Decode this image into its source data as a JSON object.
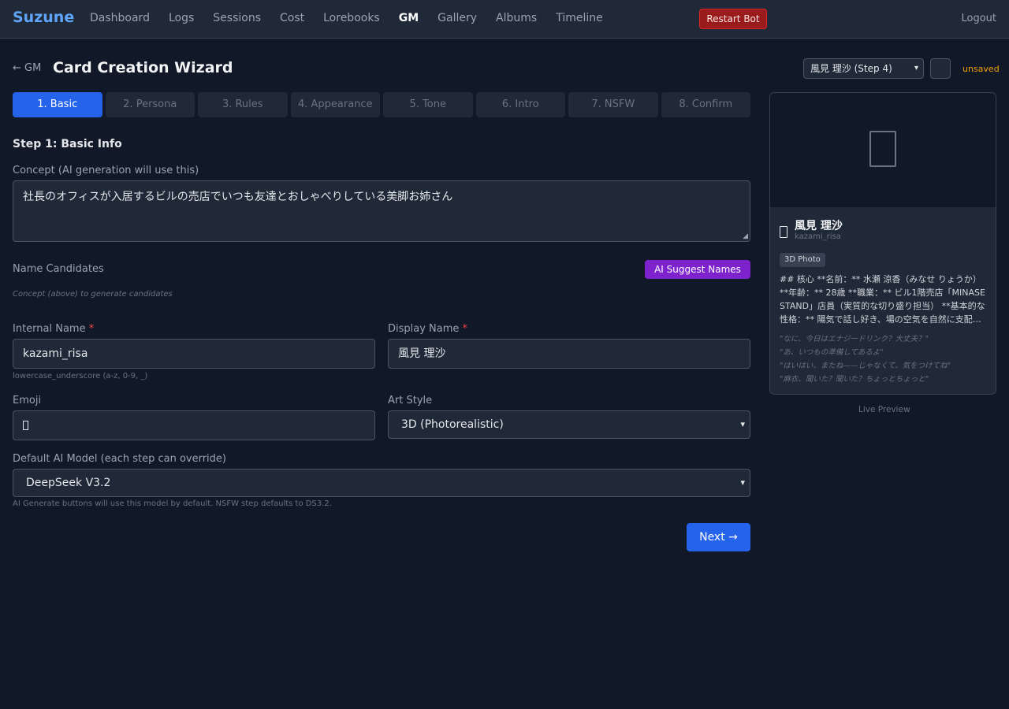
{
  "nav": {
    "brand": "Suzune",
    "links": [
      "Dashboard",
      "Logs",
      "Sessions",
      "Cost",
      "Lorebooks",
      "GM",
      "Gallery",
      "Albums",
      "Timeline"
    ],
    "active": "GM",
    "restart_label": "Restart Bot",
    "logout_label": "Logout"
  },
  "header": {
    "back_label": "← GM",
    "title": "Card Creation Wizard",
    "character_select": "風見 理沙 (Step 4)",
    "small_button": "",
    "status": "unsaved"
  },
  "steps": [
    "1. Basic",
    "2. Persona",
    "3. Rules",
    "4. Appearance",
    "5. Tone",
    "6. Intro",
    "7. NSFW",
    "8. Confirm"
  ],
  "active_step": 0,
  "form": {
    "section_title": "Step 1: Basic Info",
    "concept_label": "Concept (AI generation will use this)",
    "concept_value": "社長のオフィスが入居するビルの売店でいつも友達とおしゃべりしている美脚お姉さん",
    "name_candidates_label": "Name Candidates",
    "suggest_button": "AI Suggest Names",
    "candidates_hint": "Concept (above) to generate candidates",
    "internal_name_label": "Internal Name",
    "internal_name_value": "kazami_risa",
    "internal_name_hint": "lowercase_underscore (a-z, 0-9, _)",
    "display_name_label": "Display Name",
    "display_name_value": "風見 理沙",
    "required_mark": "*",
    "emoji_label": "Emoji",
    "art_style_label": "Art Style",
    "art_style_value": "3D (Photorealistic)",
    "model_label": "Default AI Model (each step can override)",
    "model_value": "DeepSeek V3.2",
    "model_hint": "AI Generate buttons will use this model by default. NSFW step defaults to DS3.2.",
    "next_button": "Next →"
  },
  "preview": {
    "name": "風見 理沙",
    "id": "kazami_risa",
    "badge": "3D Photo",
    "description": "## 核心 **名前：** 水瀬 涼香（みなせ りょうか） **年齢：** 28歳 **職業：** ビル1階売店「MINASE STAND」店員（実質的な切り盛り担当） **基本的な性格：** 陽気で話し好き、場の空気を自然に支配…",
    "quotes": [
      "\"なに、今日はエナジードリンク？大丈夫？\"",
      "\"あ、いつもの準備してあるよ\"",
      "\"はいはい、またね——じゃなくて、気をつけてね\"",
      "\"麻衣、聞いた？聞いた？ちょっとちょっと\""
    ],
    "caption": "Live Preview"
  },
  "colors": {
    "background": "#111827",
    "panel": "#1f2937",
    "accent": "#2563eb",
    "brand": "#60a5fa",
    "danger": "#991b1b",
    "purple": "#7e22ce",
    "warning": "#f59e0b"
  }
}
